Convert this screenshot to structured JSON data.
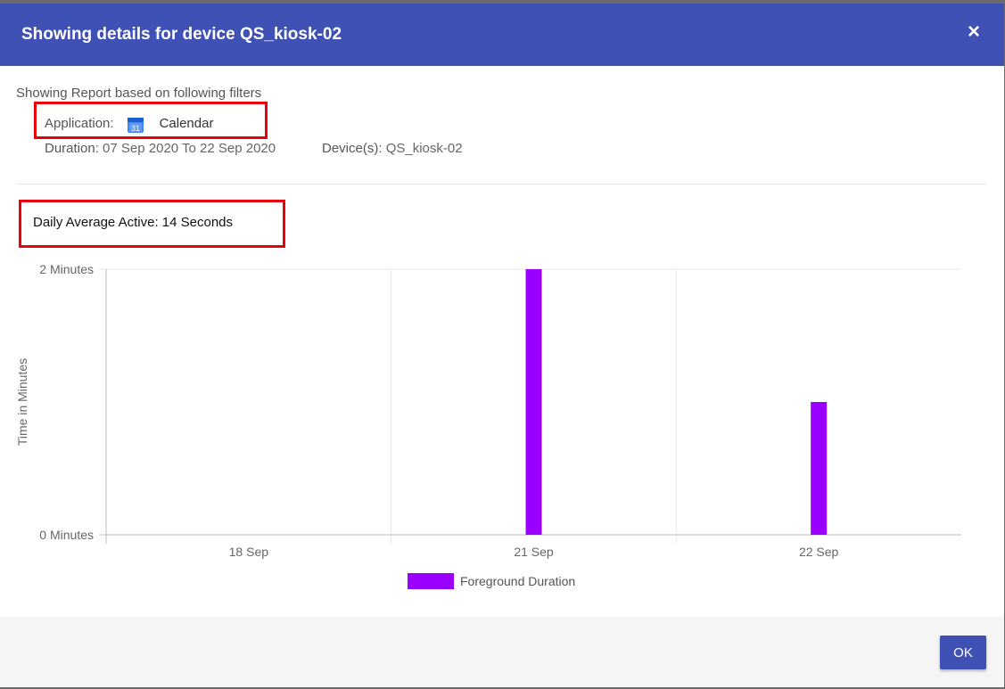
{
  "dialog": {
    "title": "Showing details for device QS_kiosk-02",
    "close_label": "×"
  },
  "filters": {
    "heading": "Showing Report based on following filters",
    "application_label": "Application:",
    "application_name": "Calendar",
    "application_icon": "calendar-icon",
    "calendar_day": "31",
    "duration_label": "Duration:",
    "duration_value": "07 Sep 2020 To 22 Sep 2020",
    "devices_label": "Device(s):",
    "devices_value": "QS_kiosk-02"
  },
  "summary": {
    "daily_average_label": "Daily Average Active: 14 Seconds"
  },
  "highlight_color": "#e8000b",
  "chart_data": {
    "type": "bar",
    "categories": [
      "18 Sep",
      "21 Sep",
      "22 Sep"
    ],
    "series": [
      {
        "name": "Foreground Duration",
        "values": [
          0,
          2,
          1
        ],
        "color": "#9900ff"
      }
    ],
    "ylabel": "Time in Minutes",
    "yticks": [
      "0 Minutes",
      "2 Minutes"
    ],
    "ylim": [
      0,
      2
    ],
    "grid": true,
    "legend": "bottom"
  },
  "footer": {
    "ok_label": "OK"
  },
  "colors": {
    "header": "#3f51b5",
    "bar": "#9900ff"
  }
}
